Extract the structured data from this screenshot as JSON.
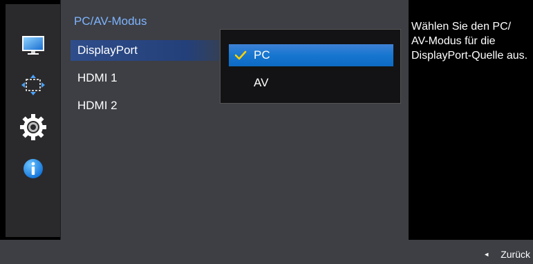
{
  "menu": {
    "title": "PC/AV-Modus",
    "items": [
      {
        "label": "DisplayPort",
        "selected": true
      },
      {
        "label": "HDMI 1",
        "selected": false
      },
      {
        "label": "HDMI 2",
        "selected": false
      }
    ]
  },
  "submenu": {
    "options": [
      {
        "label": "PC",
        "selected": true
      },
      {
        "label": "AV",
        "selected": false
      }
    ]
  },
  "description": {
    "text": "Wählen Sie den PC/ AV-Modus für die DisplayPort-Quelle aus."
  },
  "footer": {
    "back_label": "Zurück",
    "back_arrow": "◄"
  },
  "sidebar": {
    "icons": [
      "picture-icon",
      "screen-size-icon",
      "settings-icon",
      "info-icon"
    ],
    "selected": "settings-icon"
  },
  "colors": {
    "panel": "#3d3f44",
    "title": "#7fb4ff",
    "selection_blue": "#1676cf",
    "checkmark": "#ffd200"
  }
}
